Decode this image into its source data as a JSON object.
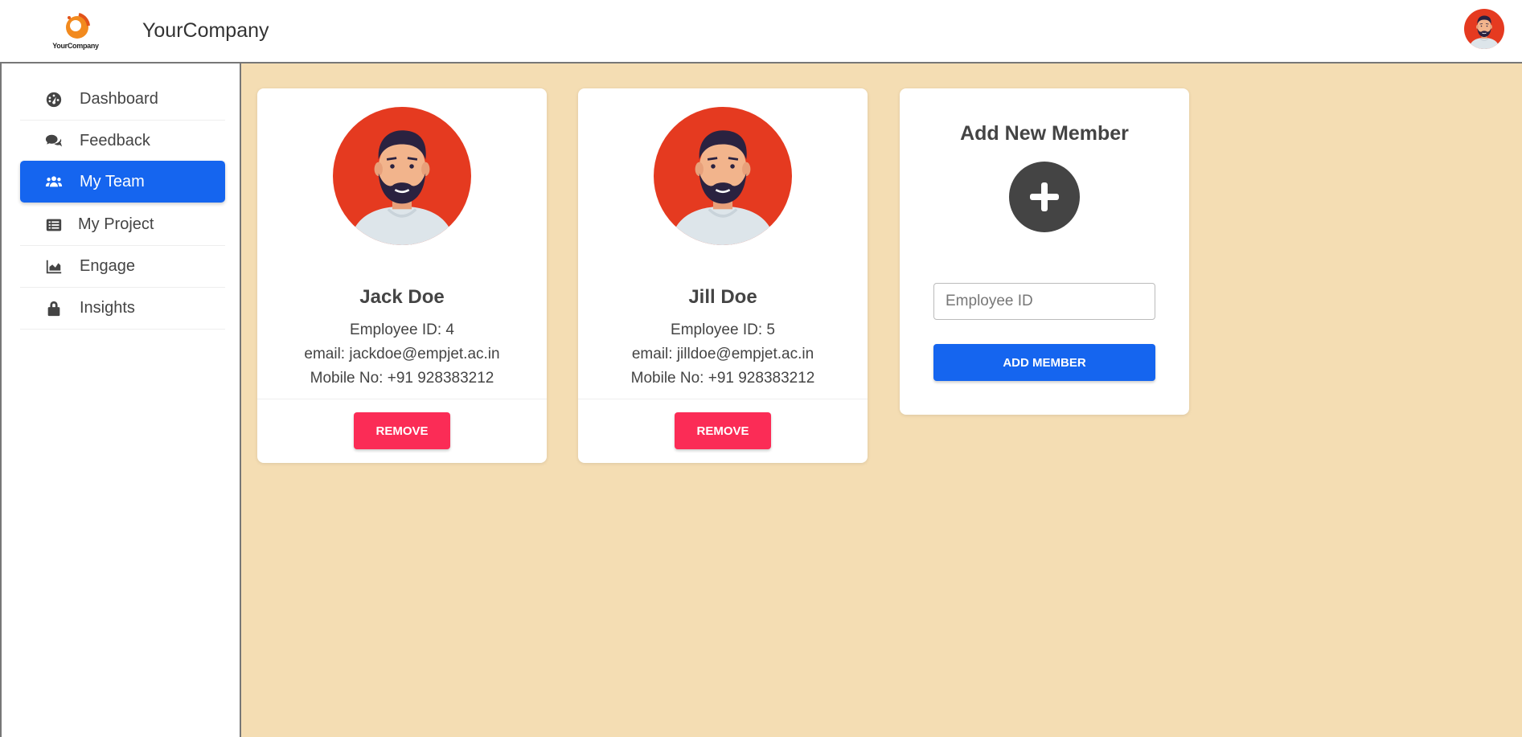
{
  "app": {
    "brand": "YourCompany",
    "logo_text": "YourCompany"
  },
  "sidebar": {
    "items": [
      {
        "label": "Dashboard",
        "icon": "dashboard-gauge-icon",
        "active": false
      },
      {
        "label": "Feedback",
        "icon": "comments-icon",
        "active": false
      },
      {
        "label": "My Team",
        "icon": "users-icon",
        "active": true
      },
      {
        "label": "My Project",
        "icon": "list-icon",
        "active": false
      },
      {
        "label": "Engage",
        "icon": "area-chart-icon",
        "active": false
      },
      {
        "label": "Insights",
        "icon": "lock-icon",
        "active": false
      }
    ]
  },
  "members": [
    {
      "name": "Jack Doe",
      "employee_id": "Employee ID: 4",
      "email": "email: jackdoe@empjet.ac.in",
      "mobile": "Mobile No: +91 928383212",
      "remove_label": "REMOVE"
    },
    {
      "name": "Jill Doe",
      "employee_id": "Employee ID: 5",
      "email": "email: jilldoe@empjet.ac.in",
      "mobile": "Mobile No: +91 928383212",
      "remove_label": "REMOVE"
    }
  ],
  "add_member": {
    "title": "Add New Member",
    "input_placeholder": "Employee ID",
    "input_value": "",
    "button_label": "ADD MEMBER"
  },
  "colors": {
    "background": "#f4ddb3",
    "primary": "#1565ef",
    "danger": "#fb2c56",
    "avatar_bg": "#e53a20"
  }
}
